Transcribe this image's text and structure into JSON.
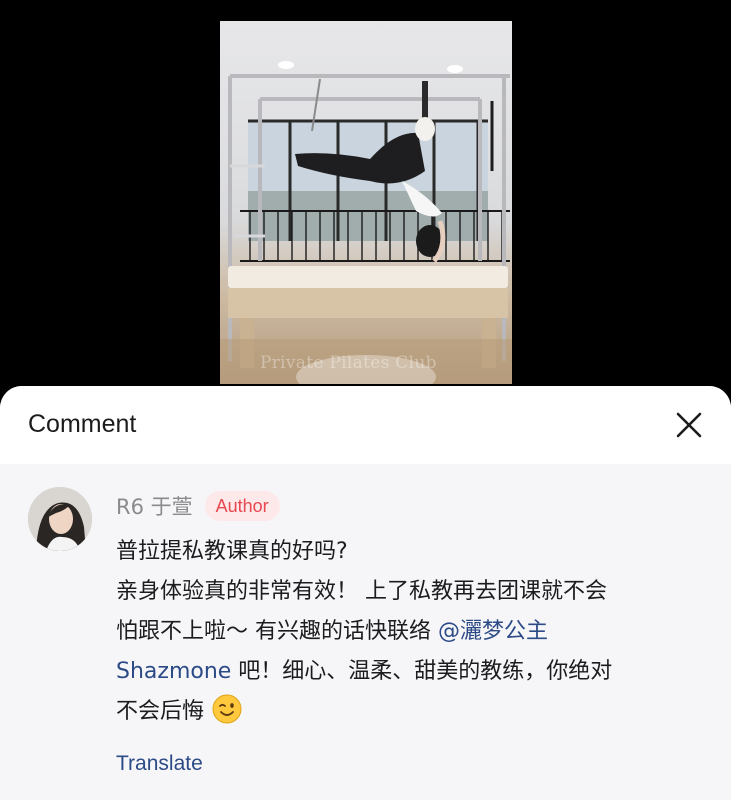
{
  "video": {
    "watermark": "Private Pilates Club"
  },
  "comments_panel": {
    "title": "Comment",
    "close_icon": "close-icon"
  },
  "comment": {
    "author": "R6 于萱",
    "badge": "Author",
    "line1": "普拉提私教课真的好吗?",
    "line2": "亲身体验真的非常有效！ 上了私教再去团课就不会",
    "line3_text": "怕跟不上啦～ 有兴趣的话快联络 ",
    "line3_mention": "@灑梦公主",
    "line4_mention": "Shazmone",
    "line4_text": " 吧！细心、温柔、甜美的教练，你绝对",
    "line5_text": "不会后悔",
    "emoji": "winking-face-emoji",
    "translate": "Translate"
  },
  "colors": {
    "mention": "#2b4a86",
    "badge_text": "#e8484f",
    "badge_bg": "#fde8ea",
    "sheet_bg": "#f6f6f8"
  }
}
